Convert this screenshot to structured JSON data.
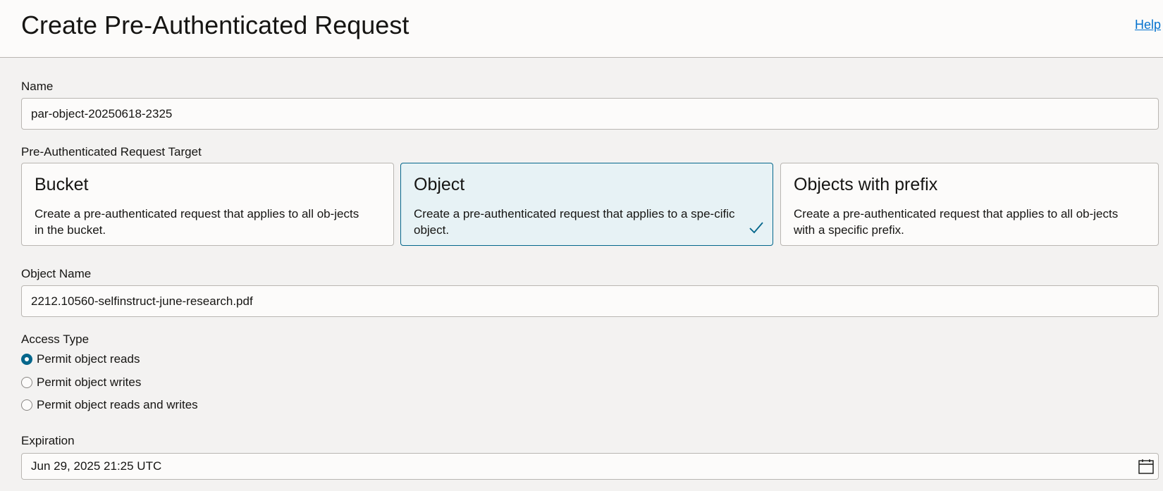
{
  "header": {
    "title": "Create Pre-Authenticated Request",
    "help_label": "Help"
  },
  "name": {
    "label": "Name",
    "value": "par-object-20250618-2325"
  },
  "target": {
    "label": "Pre-Authenticated Request Target",
    "options": [
      {
        "title": "Bucket",
        "description": "Create a pre-authenticated request that applies to all ob-jects in the bucket.",
        "selected": false
      },
      {
        "title": "Object",
        "description": "Create a pre-authenticated request that applies to a spe-cific object.",
        "selected": true
      },
      {
        "title": "Objects with prefix",
        "description": "Create a pre-authenticated request that applies to all ob-jects with a specific prefix.",
        "selected": false
      }
    ],
    "selected_icon": "checkmark-icon"
  },
  "object_name": {
    "label": "Object Name",
    "value": "2212.10560-selfinstruct-june-research.pdf"
  },
  "access_type": {
    "label": "Access Type",
    "options": [
      {
        "label": "Permit object reads",
        "checked": true
      },
      {
        "label": "Permit object writes",
        "checked": false
      },
      {
        "label": "Permit object reads and writes",
        "checked": false
      }
    ]
  },
  "expiration": {
    "label": "Expiration",
    "value": "Jun 29, 2025 21:25 UTC",
    "icon": "calendar-icon"
  },
  "colors": {
    "accent": "#04668b",
    "link": "#0572ce",
    "selected_card_bg": "#e7f2f5",
    "page_bg": "#f3f2f1"
  }
}
